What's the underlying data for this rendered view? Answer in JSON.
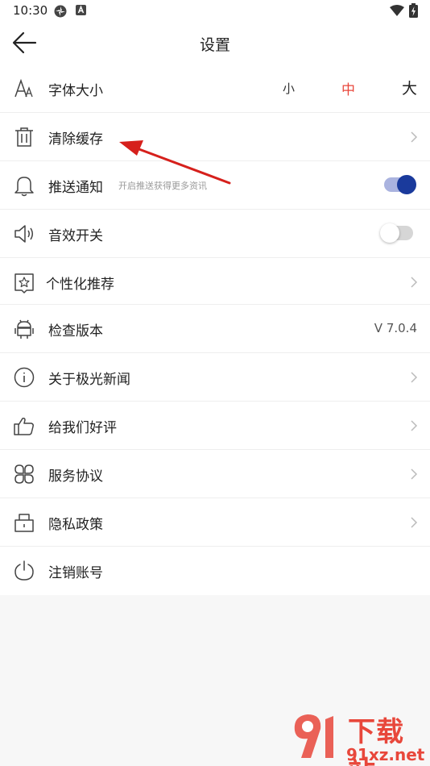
{
  "status": {
    "time": "10:30"
  },
  "appbar": {
    "title": "设置"
  },
  "settings": {
    "font_size": {
      "label": "字体大小",
      "small": "小",
      "medium": "中",
      "large": "大"
    },
    "clear_cache": {
      "label": "清除缓存"
    },
    "push": {
      "label": "推送通知",
      "sub": "开启推送获得更多资讯",
      "on": true
    },
    "sound": {
      "label": "音效开关",
      "on": false
    },
    "personal": {
      "label": "个性化推荐"
    },
    "version": {
      "label": "检查版本",
      "value": "V 7.0.4"
    },
    "about": {
      "label": "关于极光新闻"
    },
    "rate": {
      "label": "给我们好评"
    },
    "service": {
      "label": "服务协议"
    },
    "privacy": {
      "label": "隐私政策"
    },
    "logout": {
      "label": "注销账号"
    }
  },
  "watermark": {
    "brand": "下载站",
    "domain": "91xz.net",
    "logo": "91"
  },
  "colors": {
    "accent": "#e8473b",
    "toggle_on": "#1a3a9c",
    "annotation_arrow": "#d6201c"
  }
}
